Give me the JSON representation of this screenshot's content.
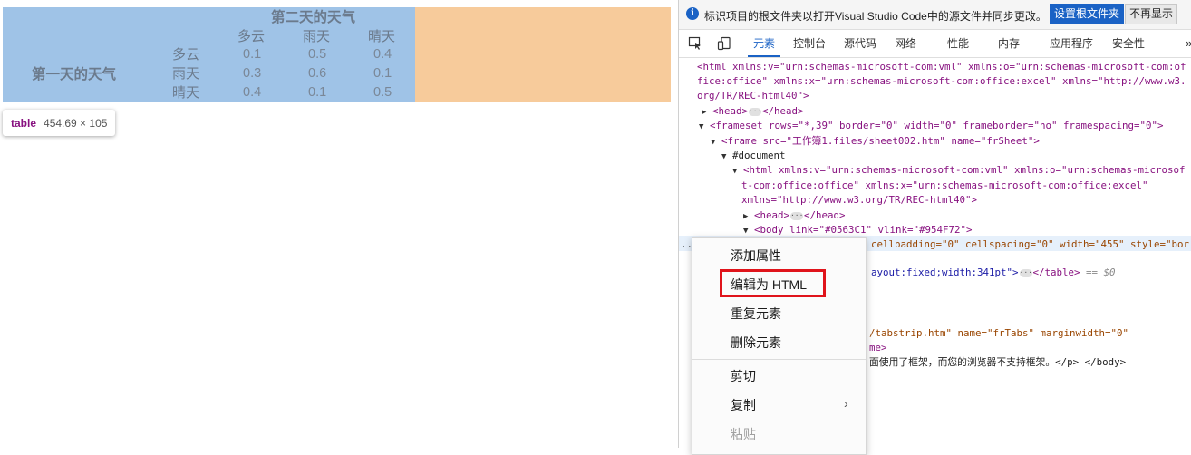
{
  "table": {
    "day2_header": "第二天的天气",
    "day1_header": "第一天的天气",
    "col_headers": [
      "多云",
      "雨天",
      "晴天"
    ],
    "rows": [
      {
        "label": "多云",
        "values": [
          "0.1",
          "0.5",
          "0.4"
        ]
      },
      {
        "label": "雨天",
        "values": [
          "0.3",
          "0.6",
          "0.1"
        ]
      },
      {
        "label": "晴天",
        "values": [
          "0.4",
          "0.1",
          "0.5"
        ]
      }
    ],
    "colors": {
      "content": "#9fc3e7",
      "margin": "#f7cb9b"
    }
  },
  "tooltip": {
    "tag": "table",
    "dimensions": "454.69 × 105"
  },
  "infobar": {
    "icon": "info-icon",
    "text": "标识项目的根文件夹以打开Visual Studio Code中的源文件并同步更改。",
    "primary_button": "设置根文件夹",
    "secondary_button": "不再显示"
  },
  "tabs": {
    "icons": [
      "inspect-element-icon",
      "device-emulation-icon"
    ],
    "items": [
      "元素",
      "控制台",
      "源代码",
      "网络",
      "性能",
      "内存",
      "应用程序",
      "安全性"
    ],
    "active": "元素",
    "more": "»"
  },
  "dom": {
    "l1a": "<html xmlns:v=\"urn:schemas-microsoft-com:vml\" xmlns:o=\"urn:schemas-microsoft-com:of",
    "l1b": "fice:office\" xmlns:x=\"urn:schemas-microsoft-com:office:excel\" xmlns=\"http://www.w3.",
    "l1c": "org/TR/REC-html40\">",
    "l2": "<head>",
    "l2end": "</head>",
    "l3": "<frameset rows=\"*,39\" border=\"0\" width=\"0\" frameborder=\"no\" framespacing=\"0\">",
    "l4": "<frame src=\"工作簿1.files/sheet002.htm\" name=\"frSheet\">",
    "l5": "#document",
    "l6a": "<html xmlns:v=\"urn:schemas-microsoft-com:vml\" xmlns:o=\"urn:schemas-microsof",
    "l6b": "t-com:office:office\" xmlns:x=\"urn:schemas-microsoft-com:office:excel\"",
    "l6c": "xmlns=\"http://www.w3.org/TR/REC-html40\">",
    "l7": "<head>",
    "l7end": "</head>",
    "l8": "<body link=\"#0563C1\" vlink=\"#954F72\">",
    "l9": "cellpadding=\"0\" cellspacing=\"0\" width=\"455\" style=\"bor",
    "l10": "ayout:fixed;width:341pt\">",
    "l10end": "</table>",
    "l10eq": "== $0",
    "l11": "/tabstrip.htm\" name=\"frTabs\" marginwidth=\"0\"",
    "l12": "me>",
    "l13": "面使用了框架，而您的浏览器不支持框架。</p> </body>",
    "dots": "..."
  },
  "context_menu": {
    "items": [
      "添加属性",
      "编辑为 HTML",
      "重复元素",
      "删除元素",
      "剪切",
      "复制",
      "粘贴"
    ],
    "highlighted": "编辑为 HTML",
    "disabled": "粘贴",
    "submenu_arrow": "chevron-right-icon"
  }
}
